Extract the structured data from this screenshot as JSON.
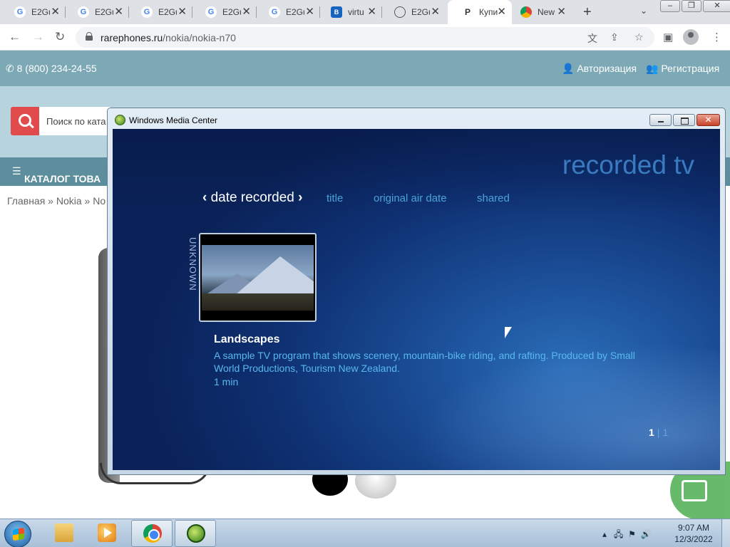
{
  "browser": {
    "tabs": [
      {
        "title": "E2Gu",
        "favicon": "google-g-icon",
        "active": false
      },
      {
        "title": "E2Gu",
        "favicon": "google-g-icon",
        "active": false
      },
      {
        "title": "E2Gu",
        "favicon": "google-g-icon",
        "active": false
      },
      {
        "title": "E2Gu",
        "favicon": "google-g-icon",
        "active": false
      },
      {
        "title": "E2Gu",
        "favicon": "google-g-icon",
        "active": false
      },
      {
        "title": "virtu",
        "favicon": "blue-square-icon",
        "active": false
      },
      {
        "title": "E2Gu",
        "favicon": "globe-icon",
        "active": false
      },
      {
        "title": "Купи",
        "favicon": "rarephones-icon",
        "active": true
      },
      {
        "title": "New",
        "favicon": "chrome-icon",
        "active": false
      }
    ],
    "url_host": "rarephones.ru",
    "url_path": "/nokia/nokia-n70"
  },
  "site": {
    "phone": "8 (800) 234-24-55",
    "login": "Авторизация",
    "register": "Регистрация",
    "search_placeholder": "Поиск по ката",
    "catalog": "КАТАЛОГ ТОВА",
    "breadcrumbs": "Главная » Nokia » No"
  },
  "wmc": {
    "window_title": "Windows Media Center",
    "heading": "recorded tv",
    "sort_active": "date recorded",
    "sort_options": [
      "title",
      "original air date",
      "shared"
    ],
    "group_label": "UNKNOWN",
    "program": {
      "title": "Landscapes",
      "description": "A sample TV program that shows scenery, mountain-bike riding, and rafting. Produced by Small World Productions, Tourism New Zealand.",
      "duration": "1 min"
    },
    "pager": {
      "current": "1",
      "total": "1"
    }
  },
  "taskbar": {
    "time": "9:07 AM",
    "date": "12/3/2022"
  },
  "colors": {
    "site_top": "#7da8b5",
    "catalog_bar": "#5d8e9d",
    "wmc_text_blue": "#58b8ee",
    "search_red": "#e24b4b"
  }
}
